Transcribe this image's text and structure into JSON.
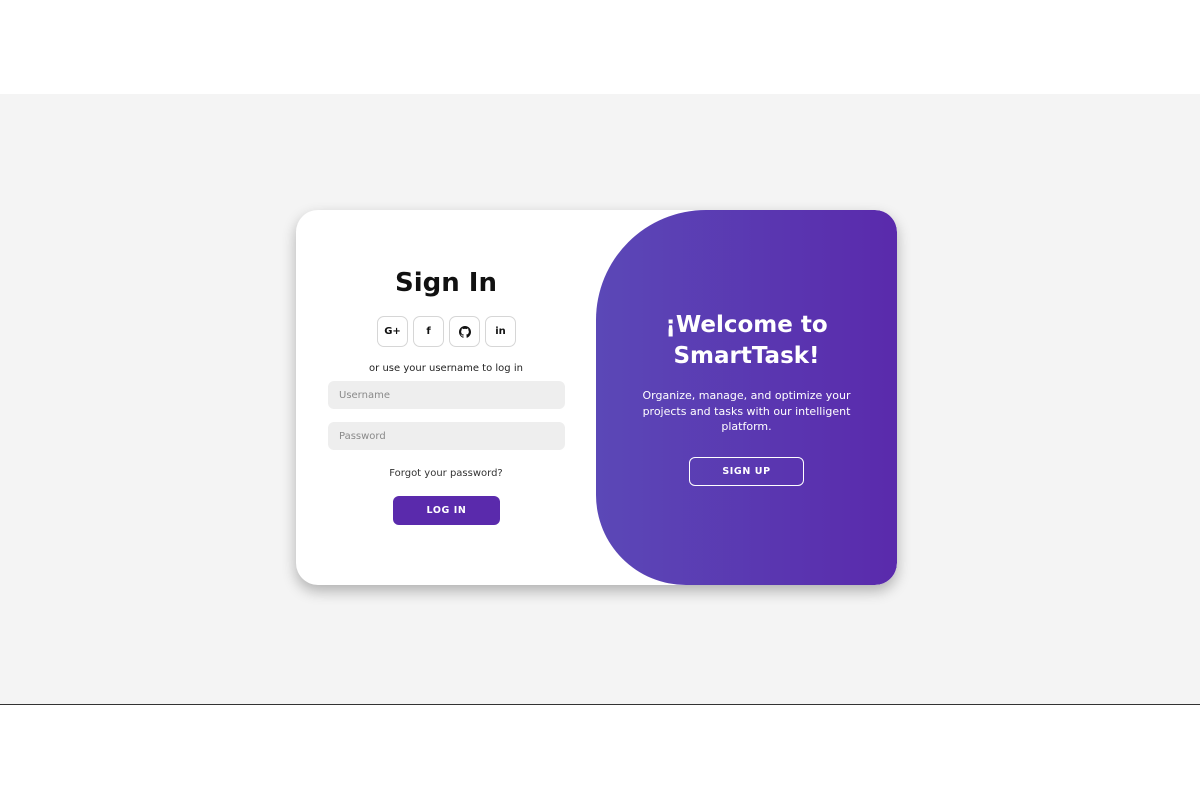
{
  "signin": {
    "title": "Sign In",
    "socials": [
      {
        "icon": "google-plus-icon",
        "label": "G+"
      },
      {
        "icon": "facebook-icon",
        "label": "f"
      },
      {
        "icon": "github-icon",
        "label": ""
      },
      {
        "icon": "linkedin-icon",
        "label": "in"
      }
    ],
    "hint": "or use your username to log in",
    "username_placeholder": "Username",
    "password_placeholder": "Password",
    "forgot": "Forgot your password?",
    "login_label": "LOG IN"
  },
  "welcome": {
    "title": "¡Welcome to SmartTask!",
    "description": "Organize, manage, and optimize your projects and tasks with our intelligent platform.",
    "signup_label": "SIGN UP"
  },
  "colors": {
    "accent": "#5a2aac",
    "panel_gradient_start": "#5b48b7",
    "panel_gradient_end": "#5a2aac",
    "page_background": "#f4f4f4"
  }
}
